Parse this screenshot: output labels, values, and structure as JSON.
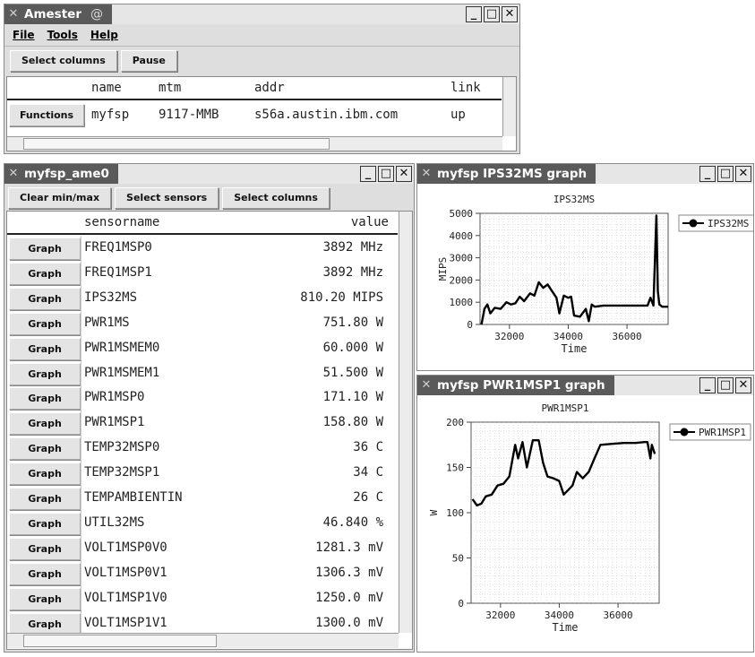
{
  "amester": {
    "title": "Amester",
    "menu": [
      "File",
      "Tools",
      "Help"
    ],
    "toolbar": {
      "select_columns": "Select columns",
      "pause": "Pause"
    },
    "table": {
      "headers": [
        "name",
        "mtm",
        "addr",
        "link"
      ],
      "rows": [
        {
          "button": "Functions",
          "name": "myfsp",
          "mtm": "9117-MMB",
          "addr": "s56a.austin.ibm.com",
          "link": "up"
        }
      ]
    }
  },
  "sensors": {
    "title": "myfsp_ame0",
    "toolbar": {
      "clear": "Clear min/max",
      "select_sensors": "Select sensors",
      "select_columns": "Select columns"
    },
    "headers": {
      "sensorname": "sensorname",
      "value": "value"
    },
    "button_label": "Graph",
    "rows": [
      {
        "name": "FREQ1MSP0",
        "value": "3892 MHz"
      },
      {
        "name": "FREQ1MSP1",
        "value": "3892 MHz"
      },
      {
        "name": "IPS32MS",
        "value": "810.20 MIPS"
      },
      {
        "name": "PWR1MS",
        "value": "751.80 W"
      },
      {
        "name": "PWR1MSMEM0",
        "value": "60.000 W"
      },
      {
        "name": "PWR1MSMEM1",
        "value": "51.500 W"
      },
      {
        "name": "PWR1MSP0",
        "value": "171.10 W"
      },
      {
        "name": "PWR1MSP1",
        "value": "158.80 W"
      },
      {
        "name": "TEMP32MSP0",
        "value": "36 C"
      },
      {
        "name": "TEMP32MSP1",
        "value": "34 C"
      },
      {
        "name": "TEMPAMBIENTIN",
        "value": "26 C"
      },
      {
        "name": "UTIL32MS",
        "value": "46.840 %"
      },
      {
        "name": "VOLT1MSP0V0",
        "value": "1281.3 mV"
      },
      {
        "name": "VOLT1MSP0V1",
        "value": "1306.3 mV"
      },
      {
        "name": "VOLT1MSP1V0",
        "value": "1250.0 mV"
      },
      {
        "name": "VOLT1MSP1V1",
        "value": "1300.0 mV"
      }
    ]
  },
  "ips_graph": {
    "window_title": "myfsp IPS32MS graph",
    "legend": "IPS32MS"
  },
  "pwr_graph": {
    "window_title": "myfsp PWR1MSP1 graph",
    "legend": "PWR1MSP1"
  },
  "chart_data": [
    {
      "type": "line",
      "title": "IPS32MS",
      "xlabel": "Time",
      "ylabel": "MIPS",
      "xlim": [
        31000,
        37400
      ],
      "ylim": [
        0,
        5000
      ],
      "xticks": [
        32000,
        34000,
        36000
      ],
      "yticks": [
        0,
        1000,
        2000,
        3000,
        4000,
        5000
      ],
      "grid": true,
      "legend_position": "right",
      "series": [
        {
          "name": "IPS32MS",
          "x": [
            31050,
            31150,
            31250,
            31350,
            31500,
            31700,
            31900,
            32050,
            32200,
            32350,
            32500,
            32700,
            32850,
            33000,
            33150,
            33300,
            33450,
            33600,
            33700,
            33850,
            34000,
            34100,
            34200,
            34400,
            34600,
            34700,
            34800,
            34900,
            35200,
            35800,
            36200,
            36500,
            36700,
            36800,
            36900,
            37000,
            37050,
            37100,
            37200,
            37400
          ],
          "y": [
            0,
            700,
            900,
            500,
            750,
            700,
            1000,
            900,
            950,
            1250,
            1050,
            1400,
            1300,
            1900,
            1650,
            1800,
            1500,
            1200,
            500,
            1300,
            1200,
            1250,
            400,
            350,
            700,
            150,
            900,
            800,
            850,
            850,
            850,
            850,
            850,
            1200,
            850,
            4900,
            1500,
            900,
            800,
            800
          ]
        }
      ]
    },
    {
      "type": "line",
      "title": "PWR1MSP1",
      "xlabel": "Time",
      "ylabel": "W",
      "xlim": [
        31000,
        37400
      ],
      "ylim": [
        0,
        200
      ],
      "xticks": [
        32000,
        34000,
        36000
      ],
      "yticks": [
        0,
        50,
        100,
        150,
        200
      ],
      "grid": true,
      "legend_position": "right",
      "series": [
        {
          "name": "PWR1MSP1",
          "x": [
            31050,
            31200,
            31350,
            31500,
            31700,
            31900,
            32100,
            32300,
            32500,
            32600,
            32750,
            32900,
            33100,
            33300,
            33450,
            33600,
            33800,
            34000,
            34150,
            34300,
            34450,
            34600,
            34800,
            35000,
            35200,
            35400,
            35800,
            36200,
            36600,
            36900,
            37000,
            37100,
            37150,
            37250
          ],
          "y": [
            115,
            108,
            110,
            118,
            120,
            130,
            132,
            140,
            175,
            160,
            178,
            150,
            180,
            180,
            155,
            140,
            138,
            135,
            120,
            125,
            130,
            145,
            138,
            145,
            160,
            175,
            176,
            177,
            177,
            178,
            178,
            160,
            175,
            165
          ]
        }
      ]
    }
  ]
}
